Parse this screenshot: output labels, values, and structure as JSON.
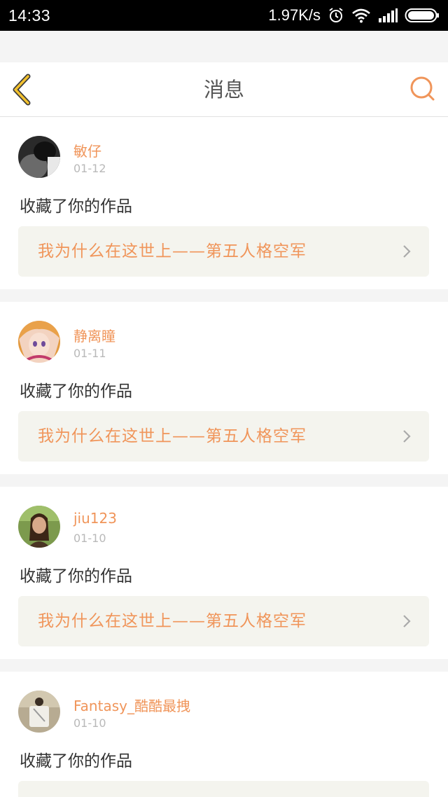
{
  "status_bar": {
    "time": "14:33",
    "network_speed": "1.97K/s",
    "icons": [
      "alarm-icon",
      "wifi-icon",
      "signal-icon",
      "battery-icon"
    ]
  },
  "header": {
    "title": "消息",
    "back_icon": "chevron-left-icon",
    "search_icon": "search-icon"
  },
  "colors": {
    "accent": "#f0955a",
    "back_icon_yellow": "#f2c12e",
    "card_bg": "#f4f4ee",
    "page_bg": "#f4f4f4"
  },
  "messages": [
    {
      "username": "敏仔",
      "date": "01-12",
      "action": "收藏了你的作品",
      "work_title": "我为什么在这世上——第五人格空军"
    },
    {
      "username": "静离瞳",
      "date": "01-11",
      "action": "收藏了你的作品",
      "work_title": "我为什么在这世上——第五人格空军"
    },
    {
      "username": "jiu123",
      "date": "01-10",
      "action": "收藏了你的作品",
      "work_title": "我为什么在这世上——第五人格空军"
    },
    {
      "username": "Fantasy_酷酷最拽",
      "date": "01-10",
      "action": "收藏了你的作品",
      "work_title": ""
    }
  ]
}
